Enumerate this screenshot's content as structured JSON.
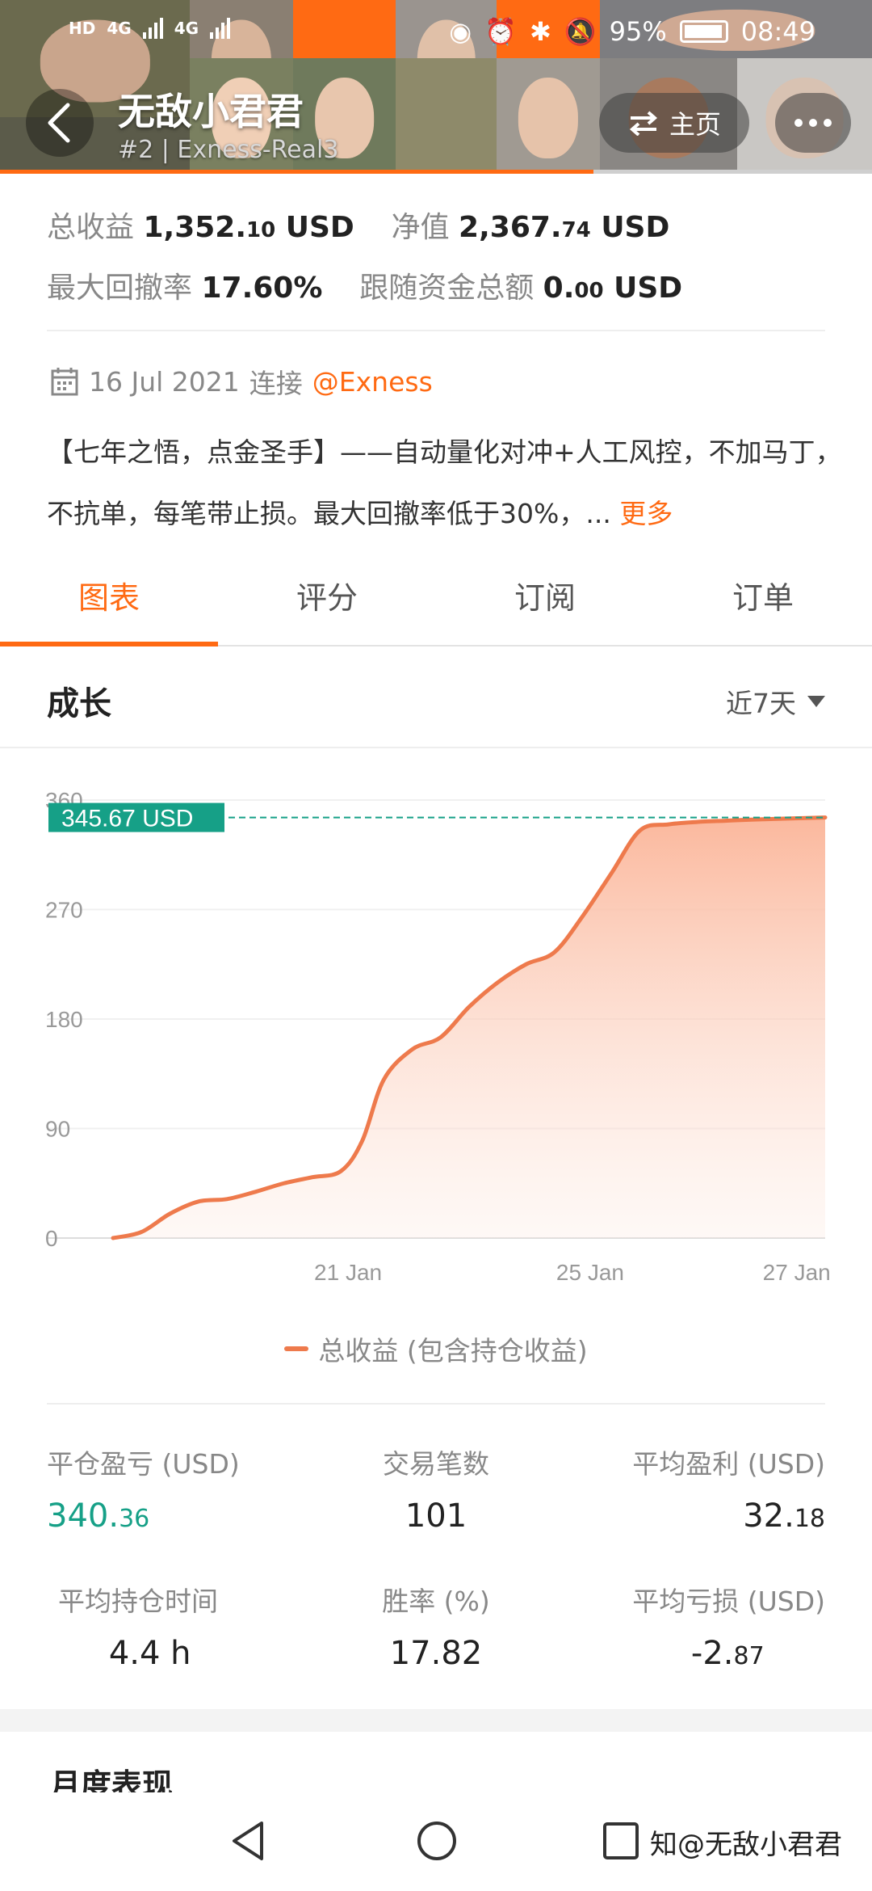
{
  "status_bar": {
    "net1": "HD",
    "net2": "4G",
    "net3": "4G",
    "battery": "95%",
    "time": "08:49"
  },
  "header": {
    "title": "无敌小君君",
    "subtitle": "#2 | Exness-Real3",
    "home_label": "主页"
  },
  "stats": {
    "profit_label": "总收益",
    "profit_int": "1,352.",
    "profit_dec": "10",
    "profit_unit": "USD",
    "equity_label": "净值",
    "equity_int": "2,367.",
    "equity_dec": "74",
    "equity_unit": "USD",
    "drawdown_label": "最大回撤率",
    "drawdown_value": "17.60%",
    "follow_label": "跟随资金总额",
    "follow_int": "0.",
    "follow_dec": "00",
    "follow_unit": "USD"
  },
  "connection": {
    "date": "16 Jul 2021",
    "text": "连接",
    "broker": "@Exness"
  },
  "description": {
    "text": "【七年之悟，点金圣手】——自动量化对冲+人工风控，不加马丁，不抗单，每笔带止损。最大回撤率低于30%，...",
    "more": "更多"
  },
  "tabs": [
    "图表",
    "评分",
    "订阅",
    "订单"
  ],
  "section": {
    "title": "成长",
    "period": "近7天"
  },
  "chart_data": {
    "type": "area",
    "y_ticks": [
      "0",
      "90",
      "180",
      "270",
      "360"
    ],
    "ylim": [
      0,
      360
    ],
    "x_ticks": [
      {
        "label": "21 Jan",
        "x": 0.33
      },
      {
        "label": "25 Jan",
        "x": 0.67
      },
      {
        "label": "27 Jan",
        "x": 0.96
      }
    ],
    "x": [
      0,
      0.04,
      0.08,
      0.12,
      0.16,
      0.2,
      0.24,
      0.28,
      0.32,
      0.35,
      0.38,
      0.42,
      0.46,
      0.5,
      0.54,
      0.58,
      0.62,
      0.66,
      0.7,
      0.74,
      0.78,
      0.82,
      0.86,
      0.9,
      1.0
    ],
    "values": [
      0,
      5,
      20,
      30,
      32,
      38,
      45,
      50,
      55,
      80,
      130,
      155,
      165,
      190,
      210,
      225,
      235,
      265,
      300,
      335,
      340,
      342,
      343,
      344,
      345.67
    ],
    "current_value": "345.67 USD",
    "legend": "总收益 (包含持仓收益)",
    "colors": {
      "line": "#ee7a4c",
      "fill_top": "#fbb89d",
      "badge": "#16a087"
    }
  },
  "metrics": [
    {
      "label": "平仓盈亏 (USD)",
      "int": "340.",
      "dec": "36",
      "green": true
    },
    {
      "label": "交易笔数",
      "int": "101",
      "dec": "",
      "green": false
    },
    {
      "label": "平均盈利 (USD)",
      "int": "32.",
      "dec": "18",
      "green": false
    },
    {
      "label": "平均持仓时间",
      "int": "4.4 h",
      "dec": "",
      "green": false
    },
    {
      "label": "胜率 (%)",
      "int": "17.82",
      "dec": "",
      "green": false
    },
    {
      "label": "平均亏损 (USD)",
      "int": "-2.",
      "dec": "87",
      "green": false
    }
  ],
  "monthly_title": "月度表现",
  "watermark": "知@无敌小君君"
}
